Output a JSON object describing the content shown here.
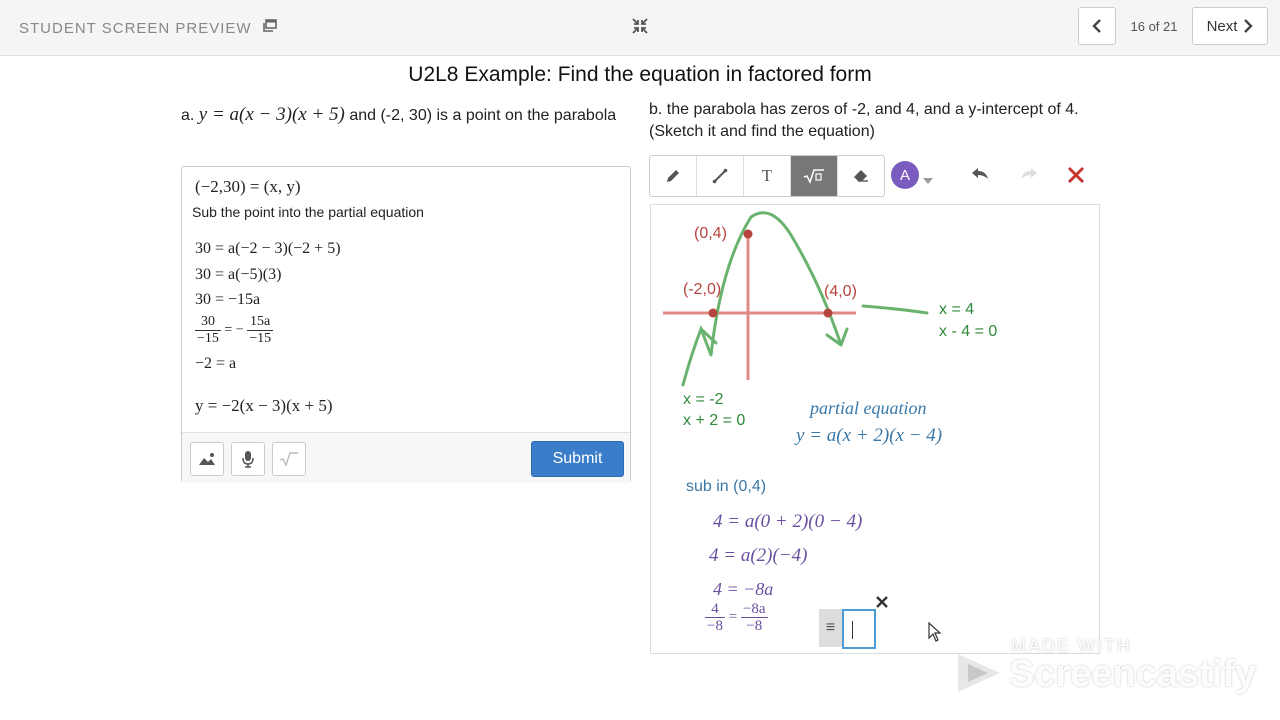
{
  "header": {
    "preview_label": "STUDENT SCREEN PREVIEW",
    "page_count": "16 of 21",
    "next_label": "Next"
  },
  "title": "U2L8 Example: Find the equation in factored form",
  "part_a": {
    "prefix": "a.",
    "equation": "y = a(x − 3)(x + 5)",
    "suffix": "and (-2, 30) is a point on the parabola"
  },
  "part_b": {
    "text": "b. the parabola has zeros of -2, and 4, and a y-intercept of 4. (Sketch it and find the equation)"
  },
  "answer": {
    "line1": "(−2,30) = (x, y)",
    "note": "Sub the point into the partial equation",
    "line2": "30 = a(−2 − 3)(−2 + 5)",
    "line3": "30 = a(−5)(3)",
    "line4": "30 = −15a",
    "frac_left_num": "30",
    "frac_left_den": "−15",
    "frac_mid": "= −",
    "frac_right_num": "15a",
    "frac_right_den": "−15",
    "line6": "−2 = a",
    "line7": "y = −2(x − 3)(x + 5)",
    "submit_label": "Submit"
  },
  "toolbar": {
    "text_tool": "T",
    "math_tool": "√▫",
    "avatar_letter": "A"
  },
  "canvas": {
    "pt_intercept": "(0,4)",
    "pt_left_zero": "(-2,0)",
    "pt_right_zero": "(4,0)",
    "right_zero_line1": "x = 4",
    "right_zero_line2": "x - 4 = 0",
    "left_zero_line1": "x = -2",
    "left_zero_line2": "x + 2 = 0",
    "partial_label": "partial equation",
    "partial_equation": "y = a(x + 2)(x − 4)",
    "sub_label": "sub in (0,4)",
    "work1": "4 = a(0 + 2)(0 − 4)",
    "work2": "4 = a(2)(−4)",
    "work3": "4 = −8a",
    "frac_left_num": "4",
    "frac_left_den": "−8",
    "frac_eq": "=",
    "frac_right_num": "−8a",
    "frac_right_den": "−8"
  },
  "watermark": {
    "small": "MADE WITH",
    "big": "Screencastify"
  },
  "colors": {
    "accent": "#3a7dc9",
    "ink_red": "#b5453e",
    "ink_green": "#2f8a3b",
    "ink_blue": "#3a78a8",
    "ink_purple": "#6a4fa0"
  }
}
